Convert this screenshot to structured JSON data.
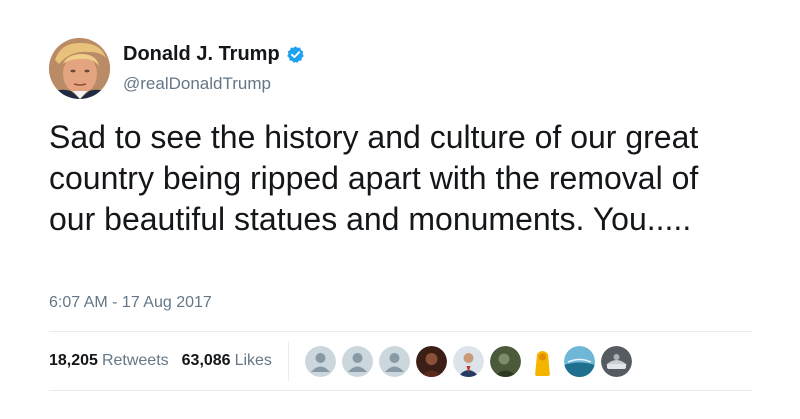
{
  "author": {
    "display_name": "Donald J. Trump",
    "handle": "@realDonaldTrump",
    "verified_icon": "verified-badge-icon",
    "avatar_icon": "profile-photo"
  },
  "tweet": {
    "text": "Sad to see the history and culture of our great country being ripped apart with the removal of our beautiful statues and monuments. You.....",
    "timestamp": "6:07 AM - 17 Aug 2017"
  },
  "stats": {
    "retweets_count": "18,205",
    "retweets_label": "Retweets",
    "likes_count": "63,086",
    "likes_label": "Likes"
  },
  "likers": [
    {
      "name": "liker-avatar-1",
      "kind": "default-egg"
    },
    {
      "name": "liker-avatar-2",
      "kind": "default-egg"
    },
    {
      "name": "liker-avatar-3",
      "kind": "default-egg"
    },
    {
      "name": "liker-avatar-4",
      "kind": "photo"
    },
    {
      "name": "liker-avatar-5",
      "kind": "photo"
    },
    {
      "name": "liker-avatar-6",
      "kind": "photo"
    },
    {
      "name": "liker-avatar-7",
      "kind": "photo"
    },
    {
      "name": "liker-avatar-8",
      "kind": "photo"
    },
    {
      "name": "liker-avatar-9",
      "kind": "photo"
    }
  ],
  "colors": {
    "text_primary": "#14171a",
    "text_secondary": "#657786",
    "verified_blue": "#1da1f2",
    "divider": "#e6ecf0"
  }
}
